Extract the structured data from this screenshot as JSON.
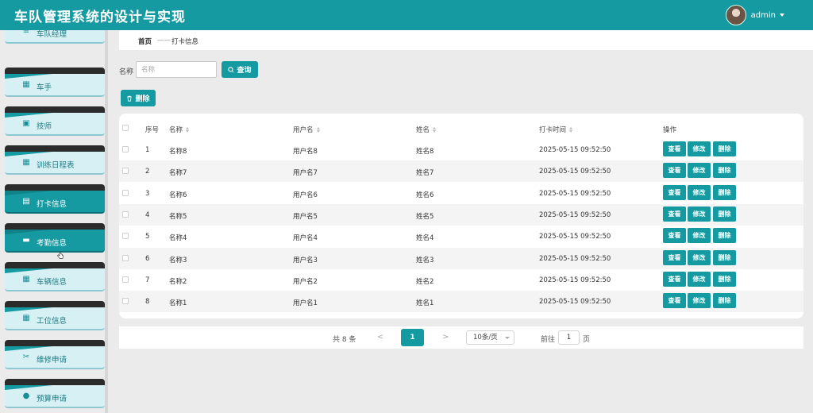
{
  "header": {
    "title": "车队管理系统的设计与实现",
    "user": "admin"
  },
  "sidebar": {
    "items": [
      {
        "label": "车队经理",
        "icon": "list-icon",
        "active": false
      },
      {
        "label": "车手",
        "icon": "grid-icon",
        "active": false
      },
      {
        "label": "技师",
        "icon": "chart-icon",
        "active": false
      },
      {
        "label": "训练日程表",
        "icon": "grid-icon",
        "active": false
      },
      {
        "label": "打卡信息",
        "icon": "clipboard-icon",
        "active": true
      },
      {
        "label": "考勤信息",
        "icon": "briefcase-icon",
        "active": true
      },
      {
        "label": "车辆信息",
        "icon": "grid-icon",
        "active": false
      },
      {
        "label": "工位信息",
        "icon": "grid-icon",
        "active": false
      },
      {
        "label": "维修申请",
        "icon": "ticket-icon",
        "active": false
      },
      {
        "label": "预算申请",
        "icon": "user-icon",
        "active": false
      }
    ]
  },
  "breadcrumb": {
    "home": "首页",
    "separator": "——",
    "current": "打卡信息"
  },
  "search": {
    "label": "名称",
    "placeholder": "名称",
    "button": "查询"
  },
  "toolbar": {
    "delete": "删除"
  },
  "table": {
    "columns": [
      "序号",
      "名称",
      "用户名",
      "姓名",
      "打卡时间",
      "操作"
    ],
    "rows": [
      {
        "no": "1",
        "name": "名称8",
        "username": "用户名8",
        "realname": "姓名8",
        "time": "2025-05-15 09:52:50"
      },
      {
        "no": "2",
        "name": "名称7",
        "username": "用户名7",
        "realname": "姓名7",
        "time": "2025-05-15 09:52:50"
      },
      {
        "no": "3",
        "name": "名称6",
        "username": "用户名6",
        "realname": "姓名6",
        "time": "2025-05-15 09:52:50"
      },
      {
        "no": "4",
        "name": "名称5",
        "username": "用户名5",
        "realname": "姓名5",
        "time": "2025-05-15 09:52:50"
      },
      {
        "no": "5",
        "name": "名称4",
        "username": "用户名4",
        "realname": "姓名4",
        "time": "2025-05-15 09:52:50"
      },
      {
        "no": "6",
        "name": "名称3",
        "username": "用户名3",
        "realname": "姓名3",
        "time": "2025-05-15 09:52:50"
      },
      {
        "no": "7",
        "name": "名称2",
        "username": "用户名2",
        "realname": "姓名2",
        "time": "2025-05-15 09:52:50"
      },
      {
        "no": "8",
        "name": "名称1",
        "username": "用户名1",
        "realname": "姓名1",
        "time": "2025-05-15 09:52:50"
      }
    ],
    "actions": [
      "查看",
      "修改",
      "删除"
    ]
  },
  "pagination": {
    "total": "共 8 条",
    "prev": "<",
    "current": "1",
    "next": ">",
    "page_size": "10条/页",
    "goto_label": "前往",
    "goto_value": "1",
    "page_unit": "页"
  },
  "colors": {
    "primary": "#149aa0",
    "sidebar_dark": "#2b2b2b",
    "sidebar_light": "#d7f0f4"
  }
}
